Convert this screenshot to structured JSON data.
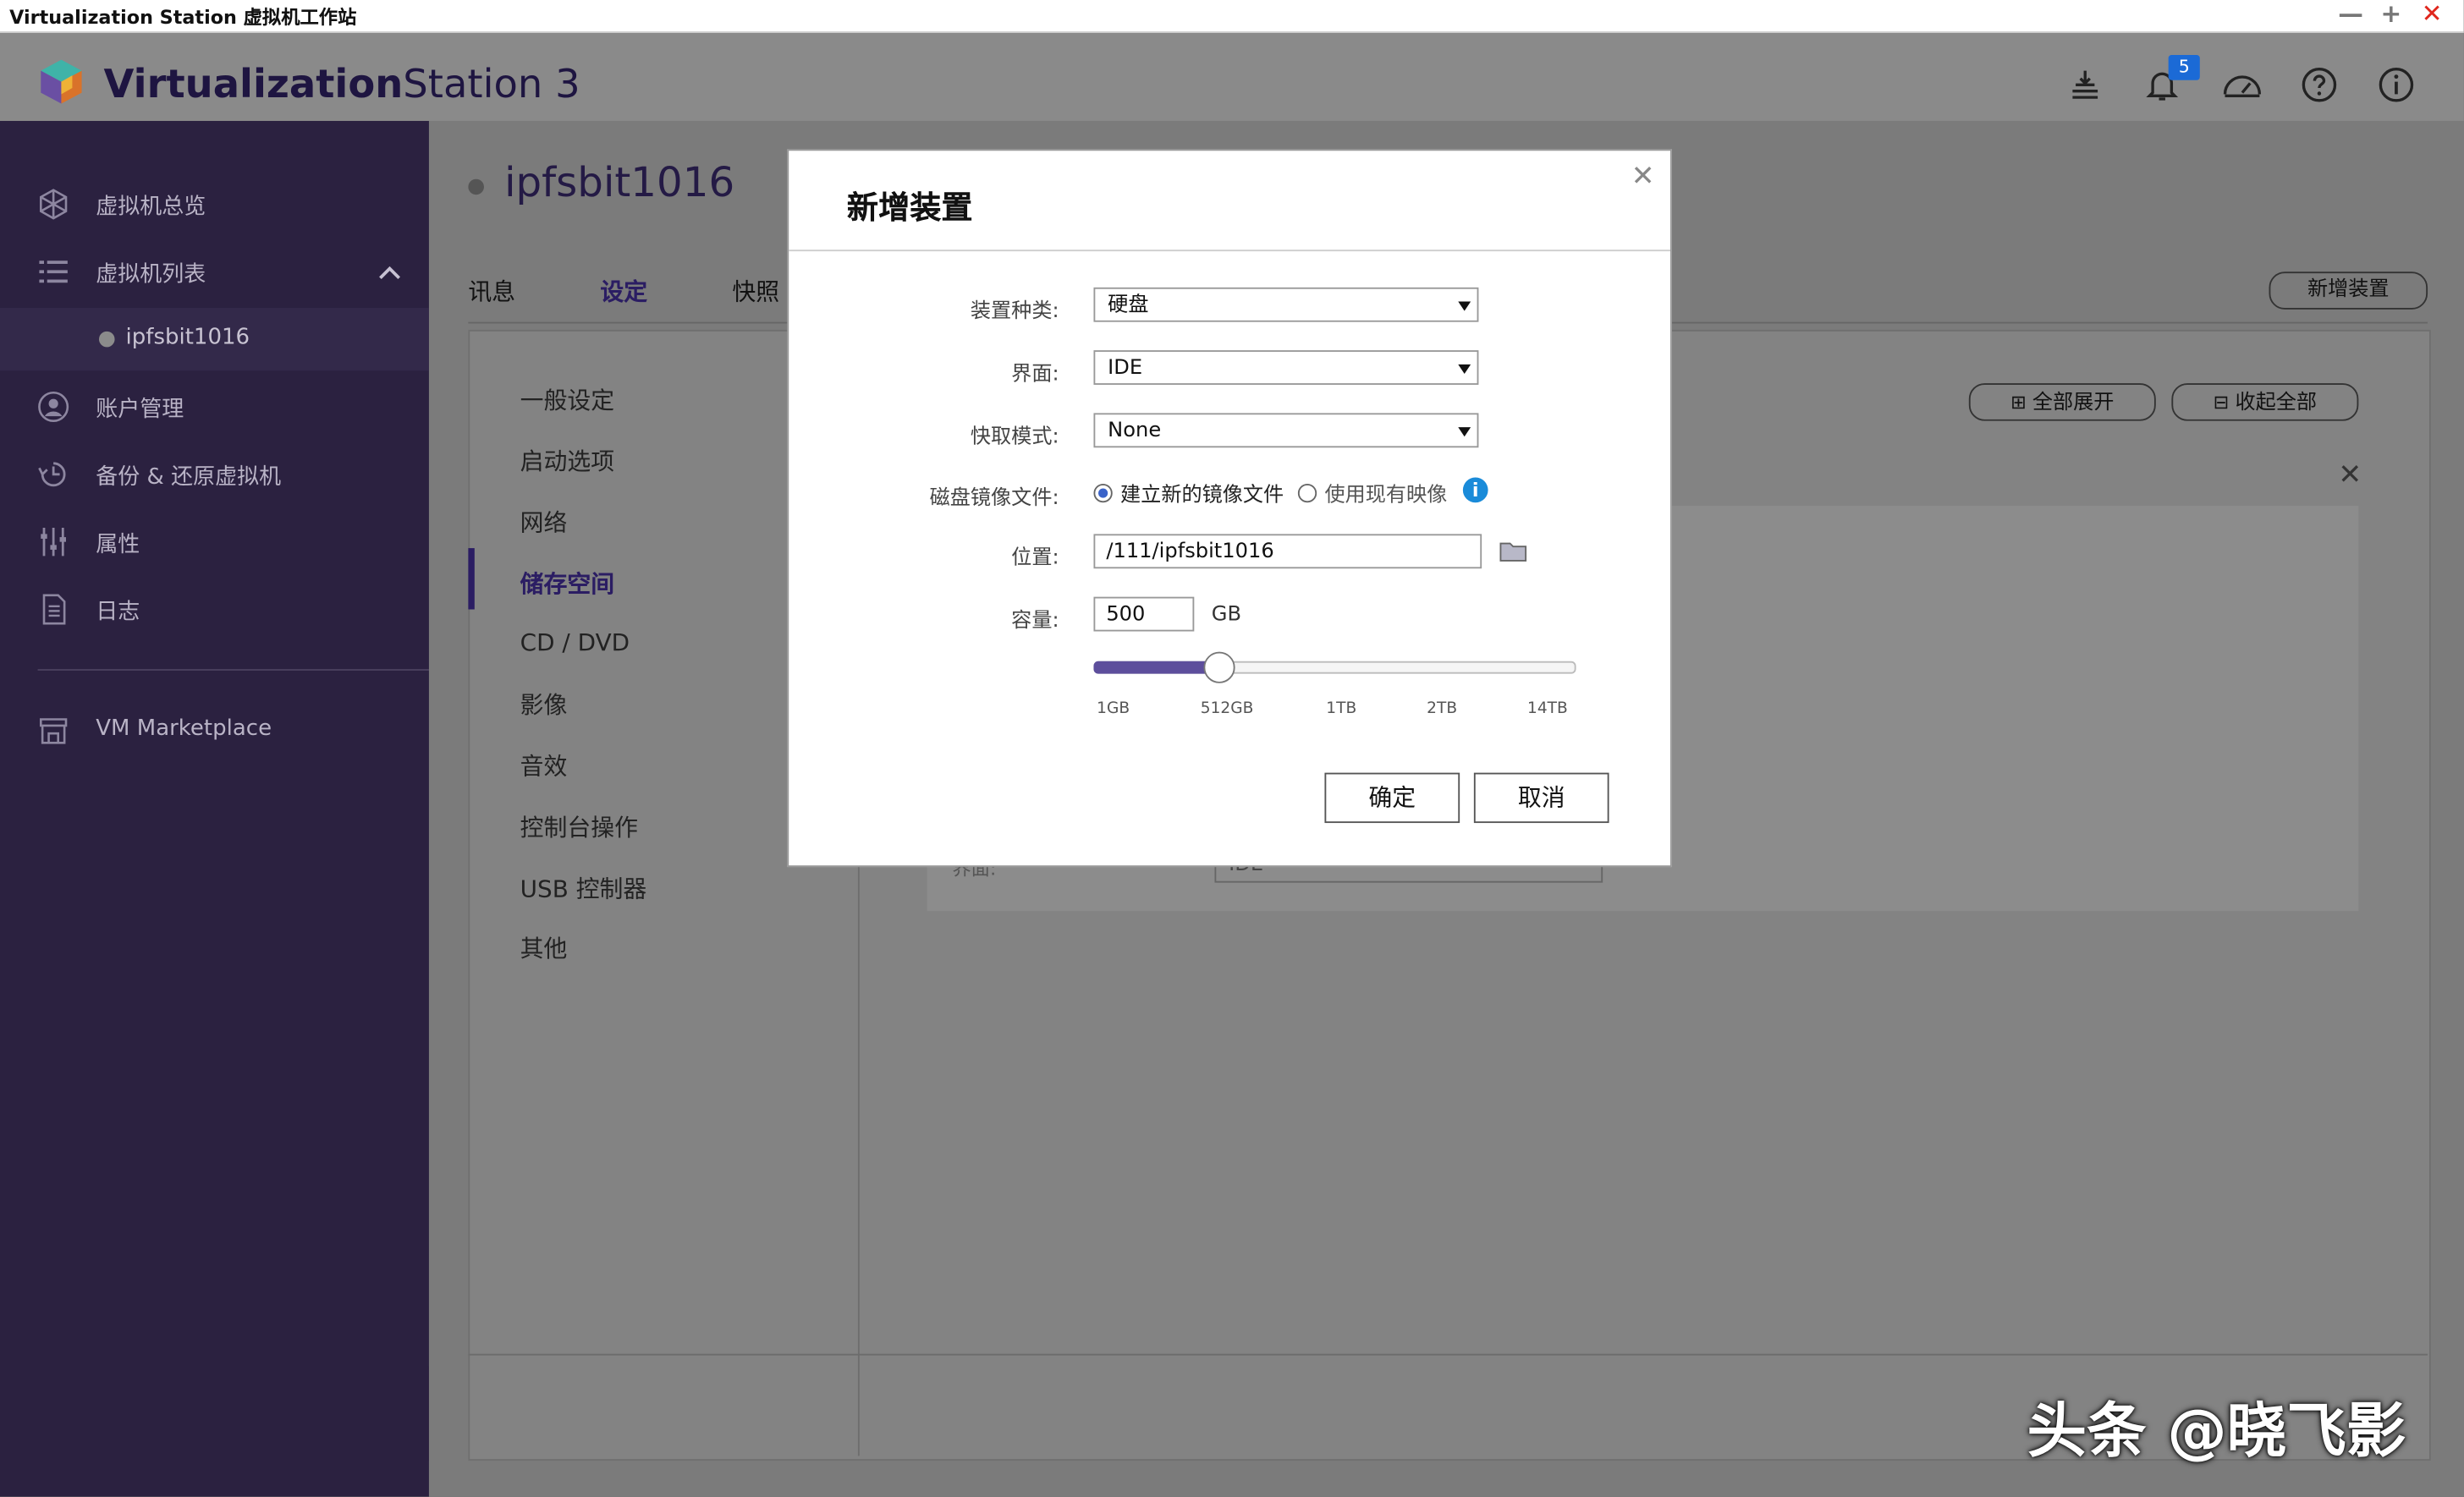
{
  "window": {
    "title": "Virtualization Station 虚拟机工作站",
    "min": "—",
    "max": "+",
    "close": "✕"
  },
  "header": {
    "brand_bold": "Virtualization",
    "brand_rest": "Station 3",
    "notif_count": "5"
  },
  "sidebar": {
    "items": [
      {
        "label": "虚拟机总览",
        "icon": "overview-icon"
      },
      {
        "label": "虚拟机列表",
        "icon": "list-icon"
      },
      {
        "label": "ipfsbit1016",
        "icon": "vm-dot"
      },
      {
        "label": "账户管理",
        "icon": "account-icon"
      },
      {
        "label": "备份 & 还原虚拟机",
        "icon": "backup-icon"
      },
      {
        "label": "属性",
        "icon": "properties-icon"
      },
      {
        "label": "日志",
        "icon": "log-icon"
      },
      {
        "label": "VM Marketplace",
        "icon": "marketplace-icon"
      }
    ]
  },
  "main": {
    "vm_name": "ipfsbit1016",
    "tabs": [
      "讯息",
      "设定",
      "快照"
    ],
    "add_device_btn": "新增装置",
    "expand_all": "全部展开",
    "collapse_all": "收起全部",
    "left_nav": [
      "一般设定",
      "启动选项",
      "网络",
      "储存空间",
      "CD / DVD",
      "影像",
      "音效",
      "控制台操作",
      "USB 控制器",
      "其他"
    ],
    "bg_label": "界面:",
    "bg_value": "IDE"
  },
  "dialog": {
    "title": "新增装置",
    "device_type_label": "装置种类:",
    "device_type_value": "硬盘",
    "interface_label": "界面:",
    "interface_value": "IDE",
    "cache_label": "快取模式:",
    "cache_value": "None",
    "disk_image_label": "磁盘镜像文件:",
    "radio_new": "建立新的镜像文件",
    "radio_existing": "使用现有映像",
    "location_label": "位置:",
    "location_value": "/111/ipfsbit1016",
    "capacity_label": "容量:",
    "capacity_value": "500",
    "capacity_unit": "GB",
    "slider_ticks": [
      "1GB",
      "512GB",
      "1TB",
      "2TB",
      "14TB"
    ],
    "slider_fraction": 0.26,
    "ok": "确定",
    "cancel": "取消"
  },
  "watermark": "头条 @晓飞影"
}
